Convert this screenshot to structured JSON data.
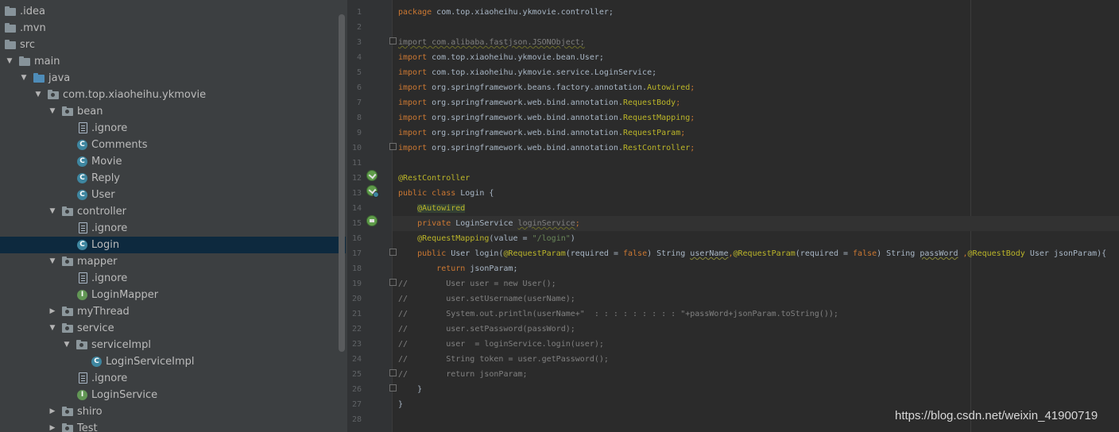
{
  "project_tree": {
    "items": [
      {
        "label": ".idea"
      },
      {
        "label": ".mvn"
      },
      {
        "label": "src"
      },
      {
        "label": "main"
      },
      {
        "label": "java"
      },
      {
        "label": "com.top.xiaoheihu.ykmovie"
      },
      {
        "label": "bean"
      },
      {
        "label": ".ignore"
      },
      {
        "label": "Comments"
      },
      {
        "label": "Movie"
      },
      {
        "label": "Reply"
      },
      {
        "label": "User"
      },
      {
        "label": "controller"
      },
      {
        "label": ".ignore"
      },
      {
        "label": "Login"
      },
      {
        "label": "mapper"
      },
      {
        "label": ".ignore"
      },
      {
        "label": "LoginMapper"
      },
      {
        "label": "myThread"
      },
      {
        "label": "service"
      },
      {
        "label": "serviceImpl"
      },
      {
        "label": "LoginServiceImpl"
      },
      {
        "label": ".ignore"
      },
      {
        "label": "LoginService"
      },
      {
        "label": "shiro"
      },
      {
        "label": "Test"
      }
    ],
    "selected": "Login",
    "class_icon_glyph": "C",
    "interface_icon_glyph": "I"
  },
  "editor": {
    "line_numbers": [
      "1",
      "2",
      "3",
      "4",
      "5",
      "6",
      "7",
      "8",
      "9",
      "10",
      "11",
      "12",
      "13",
      "14",
      "15",
      "16",
      "17",
      "18",
      "19",
      "20",
      "21",
      "22",
      "23",
      "24",
      "25",
      "26",
      "27",
      "28"
    ],
    "code": {
      "l1": {
        "a": "package",
        "b": " com.top.xiaoheihu.ykmovie.controller;"
      },
      "l3": {
        "a": "import com.alibaba.fastjson.JSONObject;"
      },
      "l4": {
        "a": "import",
        "b": " com.top.xiaoheihu.ykmovie.bean.User;"
      },
      "l5": {
        "a": "import",
        "b": " com.top.xiaoheihu.ykmovie.service.LoginService;"
      },
      "l6": {
        "a": "import",
        "b": " org.springframework.beans.factory.annotation.",
        "c": "Autowired",
        "d": ";"
      },
      "l7": {
        "a": "import",
        "b": " org.springframework.web.bind.annotation.",
        "c": "RequestBody",
        "d": ";"
      },
      "l8": {
        "a": "import",
        "b": " org.springframework.web.bind.annotation.",
        "c": "RequestMapping",
        "d": ";"
      },
      "l9": {
        "a": "import",
        "b": " org.springframework.web.bind.annotation.",
        "c": "RequestParam",
        "d": ";"
      },
      "l10": {
        "a": "import",
        "b": " org.springframework.web.bind.annotation.",
        "c": "RestController",
        "d": ";"
      },
      "l12": {
        "a": "@RestController"
      },
      "l13": {
        "a": "public class",
        "b": " Login {"
      },
      "l14": {
        "a": "    ",
        "b": "@Autowired"
      },
      "l15": {
        "a": "    ",
        "b": "private",
        "c": " LoginService ",
        "d": "loginService",
        "e": ";"
      },
      "l16": {
        "a": "    ",
        "b": "@RequestMapping",
        "c": "(value = ",
        "d": "\"/login\"",
        "e": ")"
      },
      "l17": {
        "a": "    ",
        "b": "public",
        "c": " User login(",
        "d": "@RequestParam",
        "e": "(required = ",
        "f": "false",
        "g": ") String ",
        "h": "userName",
        "i": ",",
        "j": "@RequestParam",
        "k": "(required = ",
        "l": "false",
        "m": ") String ",
        "n": "passWord",
        "o": " ,",
        "p": "@RequestBody",
        "q": " User jsonParam){"
      },
      "l18": {
        "a": "        ",
        "b": "return",
        "c": " jsonParam;"
      },
      "l19": {
        "a": "//        User user = new User();"
      },
      "l20": {
        "a": "//        user.setUsername(userName);"
      },
      "l21": {
        "a": "//        System.out.println(userName+\"  : : : : : : : : : \"+passWord+jsonParam.toString());"
      },
      "l22": {
        "a": "//        user.setPassword(passWord);"
      },
      "l23": {
        "a": "//        user  = loginService.login(user);"
      },
      "l24": {
        "a": "//        String token = user.getPassword();"
      },
      "l25": {
        "a": "//        return jsonParam;"
      },
      "l26": {
        "a": "    }"
      },
      "l27": {
        "a": "}"
      }
    }
  },
  "watermark": "https://blog.csdn.net/weixin_41900719",
  "colors": {
    "keyword": "#cc7832",
    "annotation": "#bbb529",
    "string": "#6a8759",
    "comment": "#808080",
    "text": "#a9b7c6",
    "selection": "#0d293e"
  }
}
